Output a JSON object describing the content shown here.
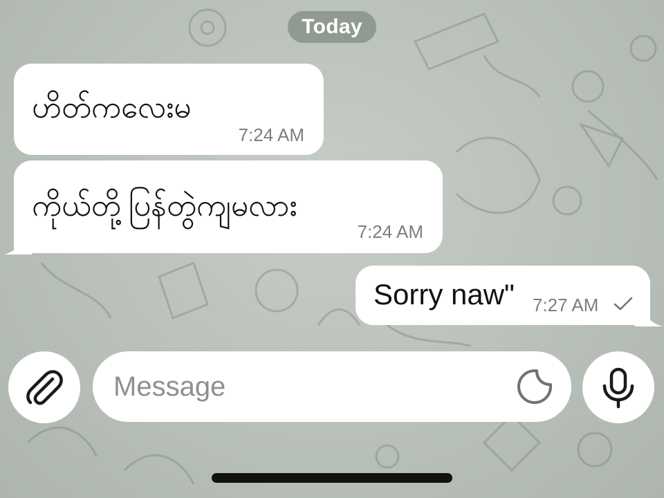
{
  "chat": {
    "date_separator": "Today",
    "messages": [
      {
        "direction": "incoming",
        "text": "ဟိတ်ကလေးမ",
        "time": "7:24 AM"
      },
      {
        "direction": "incoming",
        "text": "ကိုယ်တို့ပြန်တွဲကျမလား",
        "time": "7:24 AM"
      },
      {
        "direction": "outgoing",
        "text": "Sorry naw\"",
        "time": "7:27 AM",
        "status": "sent"
      }
    ]
  },
  "composer": {
    "placeholder": "Message",
    "value": "",
    "attach_icon": "paperclip-icon",
    "sticker_icon": "sticker-icon",
    "mic_icon": "microphone-icon"
  },
  "colors": {
    "wallpaper": "#b8c0b9",
    "bubble": "#ffffff",
    "date_pill": "#828c84",
    "timestamp": "#7a7f7c"
  }
}
